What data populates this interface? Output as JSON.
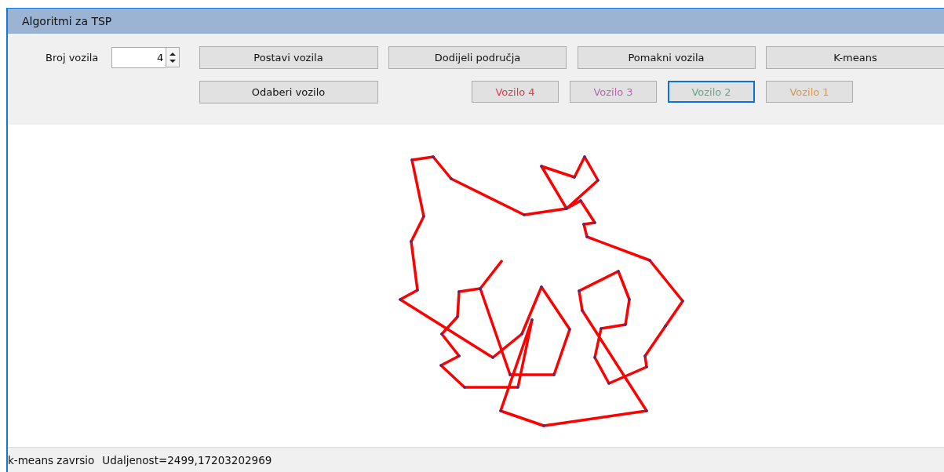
{
  "window": {
    "title": "Algoritmi za TSP"
  },
  "vehicle_count": {
    "label": "Broj vozila",
    "value": "4"
  },
  "actions": [
    "Postavi vozila",
    "Dodijeli područja",
    "Pomakni vozila",
    "K-means"
  ],
  "select_button": "Odaberi vozilo",
  "vehicles": [
    {
      "label": "Vozilo 4",
      "color": "#d83a4a",
      "selected": false
    },
    {
      "label": "Vozilo 3",
      "color": "#b766b0",
      "selected": false
    },
    {
      "label": "Vozilo 2",
      "color": "#66a88a",
      "selected": true
    },
    {
      "label": "Vozilo 1",
      "color": "#d89a4a",
      "selected": false
    }
  ],
  "status_bar": {
    "message": "k-means zavrsio",
    "distance": "Udaljenost=2499,17203202969"
  }
}
